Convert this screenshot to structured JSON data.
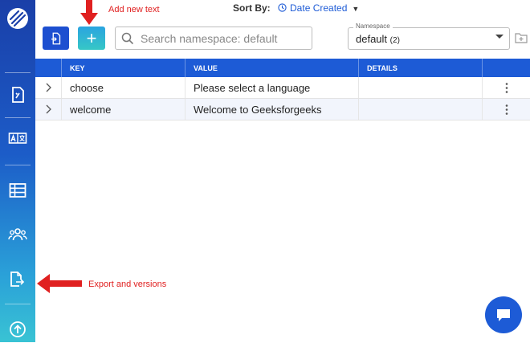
{
  "toolbar": {
    "sort_label": "Sort By:",
    "sort_value": "Date Created",
    "search_placeholder": "Search namespace: default",
    "namespace_label": "Namespace",
    "namespace_value": "default",
    "namespace_count": "(2)"
  },
  "sidebar": {
    "items": [
      {
        "icon": "translate-file-icon"
      },
      {
        "icon": "language-text-icon"
      },
      {
        "icon": "table-icon"
      },
      {
        "icon": "users-icon"
      },
      {
        "icon": "export-icon"
      },
      {
        "icon": "upgrade-arrow-icon"
      }
    ]
  },
  "table": {
    "columns": [
      "",
      "KEY",
      "VALUE",
      "DETAILS",
      ""
    ],
    "rows": [
      {
        "key": "choose",
        "value": "Please select a language",
        "details": ""
      },
      {
        "key": "welcome",
        "value": "Welcome to Geeksforgeeks",
        "details": ""
      }
    ]
  },
  "annotations": {
    "add_new_text": "Add new text",
    "export_versions": "Export and versions"
  },
  "colors": {
    "accent": "#1d5bd6",
    "annotation": "#e02020",
    "add_button": "#2fb4d6"
  }
}
